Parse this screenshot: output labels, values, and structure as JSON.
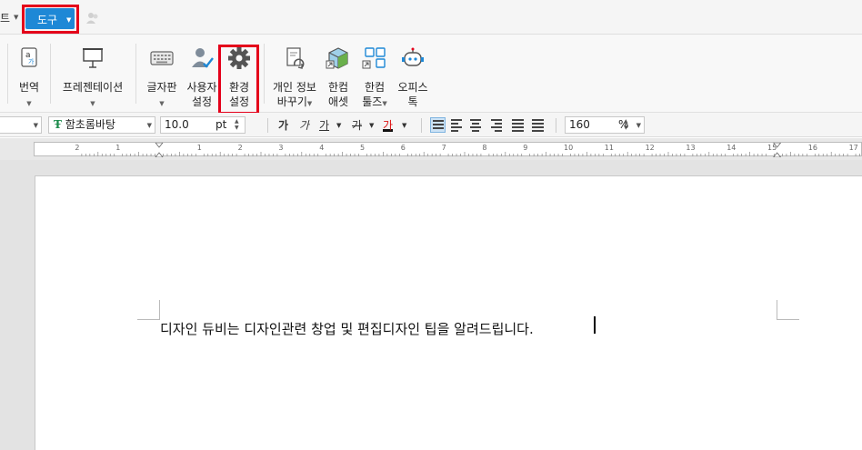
{
  "menubar": {
    "prev_tab_fragment": "트",
    "tools_tab": "도구"
  },
  "ribbon": {
    "translate": "번역",
    "presentation": "프레젠테이션",
    "keyboard": "글자판",
    "user_settings_line1": "사용자",
    "user_settings_line2": "설정",
    "env_settings_line1": "환경",
    "env_settings_line2": "설정",
    "personal_info_line1": "개인 정보",
    "personal_info_line2": "바꾸기",
    "hancom_assets_line1": "한컴",
    "hancom_assets_line2": "애셋",
    "hancom_tools_line1": "한컴",
    "hancom_tools_line2": "툴즈",
    "office_talk_line1": "오피스",
    "office_talk_line2": "톡"
  },
  "format": {
    "font_name": "함초롬바탕",
    "font_size": "10.0",
    "size_unit": "pt",
    "bold_glyph": "가",
    "italic_glyph": "가",
    "underline_glyph": "가",
    "strike_glyph": "가",
    "color_glyph": "가",
    "zoom": "160",
    "zoom_unit": "%"
  },
  "ruler": {
    "numbers": [
      "2",
      "1",
      "1",
      "2",
      "3",
      "4",
      "5",
      "6",
      "7",
      "8",
      "9",
      "10",
      "11",
      "12",
      "13",
      "14",
      "15",
      "16",
      "17"
    ]
  },
  "document": {
    "text": "디자인 듀비는 디자인관련 창업 및 편집디자인 팁을 알려드립니다."
  },
  "colors": {
    "accent": "#1e88d6",
    "highlight": "#e4001a"
  }
}
